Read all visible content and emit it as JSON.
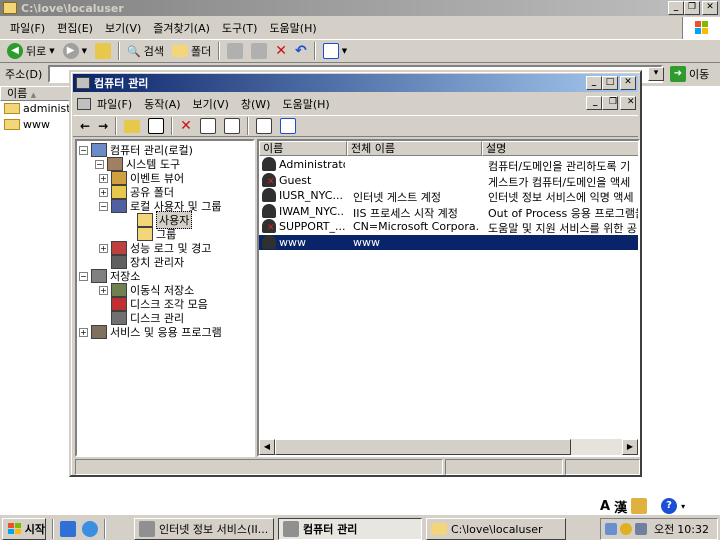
{
  "explorer": {
    "title": "C:\\love\\localuser",
    "menu": [
      "파일(F)",
      "편집(E)",
      "보기(V)",
      "즐겨찾기(A)",
      "도구(T)",
      "도움말(H)"
    ],
    "toolbar": {
      "back": "뒤로",
      "search": "검색",
      "folders": "폴더"
    },
    "address_label": "주소(D)",
    "go_label": "이동",
    "list_header": "이름",
    "files": [
      "administr",
      "www"
    ]
  },
  "mmc": {
    "title": "컴퓨터 관리",
    "menu": [
      "파일(F)",
      "동작(A)",
      "보기(V)",
      "창(W)",
      "도움말(H)"
    ],
    "tree": [
      {
        "label": "컴퓨터 관리(로컬)",
        "expander": "−",
        "icon": "computer-icon"
      },
      {
        "label": "시스템 도구",
        "expander": "−",
        "icon": "tools-icon"
      },
      {
        "label": "이벤트 뷰어",
        "expander": "+",
        "icon": "event-viewer-icon"
      },
      {
        "label": "공유 폴더",
        "expander": "+",
        "icon": "shared-folder-icon"
      },
      {
        "label": "로컬 사용자 및 그룹",
        "expander": "−",
        "icon": "users-groups-icon"
      },
      {
        "label": "사용자",
        "expander": "",
        "icon": "folder-open-icon"
      },
      {
        "label": "그룹",
        "expander": "",
        "icon": "folder-icon"
      },
      {
        "label": "성능 로그 및 경고",
        "expander": "+",
        "icon": "performance-icon"
      },
      {
        "label": "장치 관리자",
        "expander": "",
        "icon": "device-manager-icon"
      },
      {
        "label": "저장소",
        "expander": "−",
        "icon": "storage-icon"
      },
      {
        "label": "이동식 저장소",
        "expander": "+",
        "icon": "removable-storage-icon"
      },
      {
        "label": "디스크 조각 모음",
        "expander": "",
        "icon": "defrag-icon"
      },
      {
        "label": "디스크 관리",
        "expander": "",
        "icon": "disk-management-icon"
      },
      {
        "label": "서비스 및 응용 프로그램",
        "expander": "+",
        "icon": "services-icon"
      }
    ],
    "columns": [
      "이름",
      "전체 이름",
      "설명"
    ],
    "users": [
      {
        "name": "Administrator",
        "full": "",
        "desc": "컴퓨터/도메인을 관리하도록 기",
        "disabled": false
      },
      {
        "name": "Guest",
        "full": "",
        "desc": "게스트가 컴퓨터/도메인을 액세",
        "disabled": true
      },
      {
        "name": "IUSR_NYC...",
        "full": "인터넷 게스트 계정",
        "desc": "인터넷 정보 서비스에 익명 액세",
        "disabled": false
      },
      {
        "name": "IWAM_NYC...",
        "full": "IIS 프로세스 시작 계정",
        "desc": "Out of Process 응용 프로그램을",
        "disabled": false
      },
      {
        "name": "SUPPORT_...",
        "full": "CN=Microsoft Corpora...",
        "desc": "도움말 및 지원 서비스를 위한 공",
        "disabled": true
      },
      {
        "name": "www",
        "full": "www",
        "desc": "",
        "disabled": false,
        "selected": true
      }
    ]
  },
  "tray_toolbar": {
    "ime_a": "A",
    "ime_han": "漢"
  },
  "taskbar": {
    "start": "시작",
    "tasks": [
      "인터넷 정보 서비스(II...",
      "컴퓨터 관리",
      "C:\\love\\localuser"
    ],
    "ime": "오전",
    "clock": "10:32"
  },
  "colors": {
    "title_active": "#0a246a",
    "selection": "#0a246a",
    "face": "#d4d0c8"
  }
}
